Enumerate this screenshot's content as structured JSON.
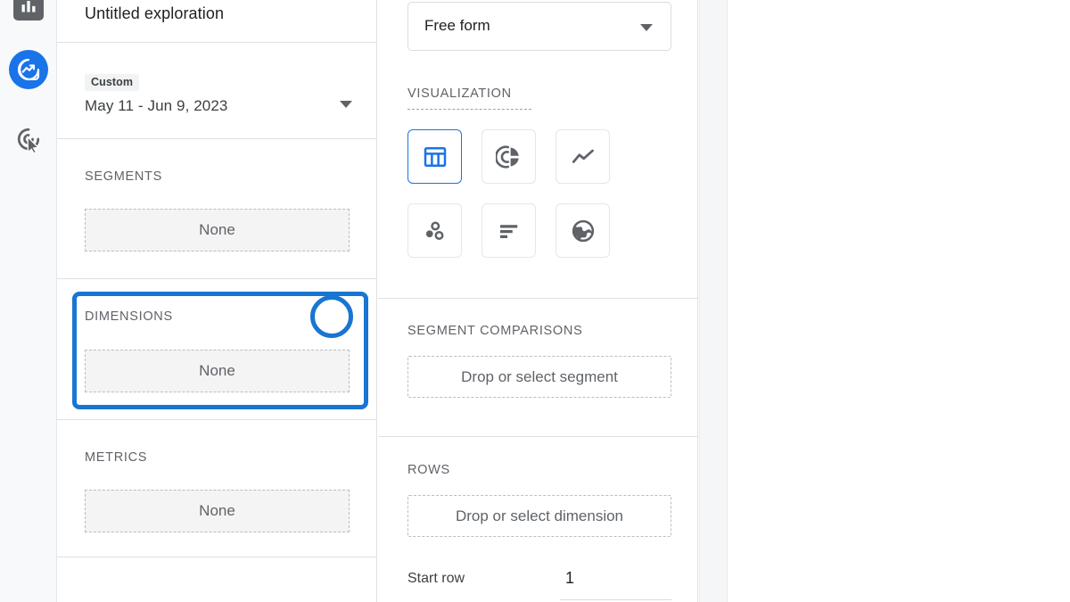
{
  "nav_rail": {
    "items": [
      {
        "name": "reports-icon",
        "label": "Reports",
        "active": false
      },
      {
        "name": "explore-icon",
        "label": "Explore",
        "active": true
      },
      {
        "name": "advertising-icon",
        "label": "Advertising",
        "active": false
      }
    ],
    "background": "#f8f9fa",
    "active_color": "#1a73e8"
  },
  "variables_panel": {
    "exploration_title": "Untitled exploration",
    "date_range": {
      "chip_label": "Custom",
      "value": "May 11 - Jun 9, 2023",
      "caret_icon": "chevron-down-icon"
    },
    "sections": [
      {
        "key": "segments",
        "heading": "SEGMENTS",
        "add_icon": "plus-icon",
        "drop_label": "None"
      },
      {
        "key": "dimensions",
        "heading": "DIMENSIONS",
        "add_icon": "plus-icon",
        "drop_label": "None"
      },
      {
        "key": "metrics",
        "heading": "METRICS",
        "add_icon": "plus-icon",
        "drop_label": "None"
      }
    ]
  },
  "tab_settings_panel": {
    "technique": {
      "value": "Free form",
      "caret_icon": "chevron-down-icon"
    },
    "visualization": {
      "heading": "VISUALIZATION",
      "options": [
        {
          "name": "free-form-table-icon",
          "label": "Free form table",
          "selected": true
        },
        {
          "name": "donut-chart-icon",
          "label": "Donut chart",
          "selected": false
        },
        {
          "name": "line-chart-icon",
          "label": "Line chart",
          "selected": false
        },
        {
          "name": "scatter-plot-icon",
          "label": "Scatter plot",
          "selected": false
        },
        {
          "name": "bar-chart-icon",
          "label": "Bar chart",
          "selected": false
        },
        {
          "name": "geo-map-icon",
          "label": "Geo map",
          "selected": false
        }
      ]
    },
    "segment_comparisons": {
      "heading": "SEGMENT COMPARISONS",
      "drop_label": "Drop or select segment"
    },
    "rows": {
      "heading": "ROWS",
      "drop_label": "Drop or select dimension",
      "start_row_label": "Start row",
      "start_row_value": "1"
    }
  },
  "annotation": {
    "target": "dimensions-section",
    "color": "#1876d2",
    "circle_target": "dimensions-add-button"
  }
}
